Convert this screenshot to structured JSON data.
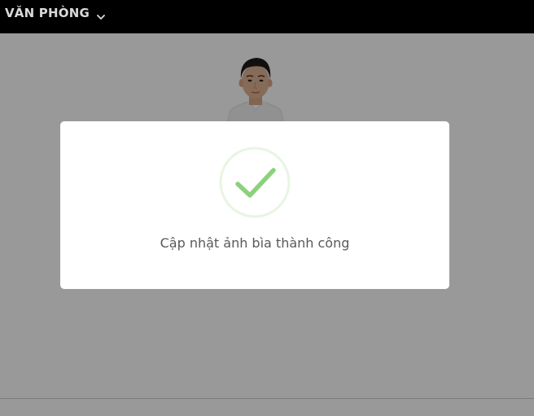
{
  "header": {
    "office_label": "VĂN PHÒNG",
    "chevron_icon": "chevron-down-icon"
  },
  "profile": {
    "avatar_icon": "profile-photo"
  },
  "dialog": {
    "icon": "checkmark-icon",
    "message": "Cập nhật ảnh bìa thành công",
    "accent_color": "#8cd17d"
  }
}
